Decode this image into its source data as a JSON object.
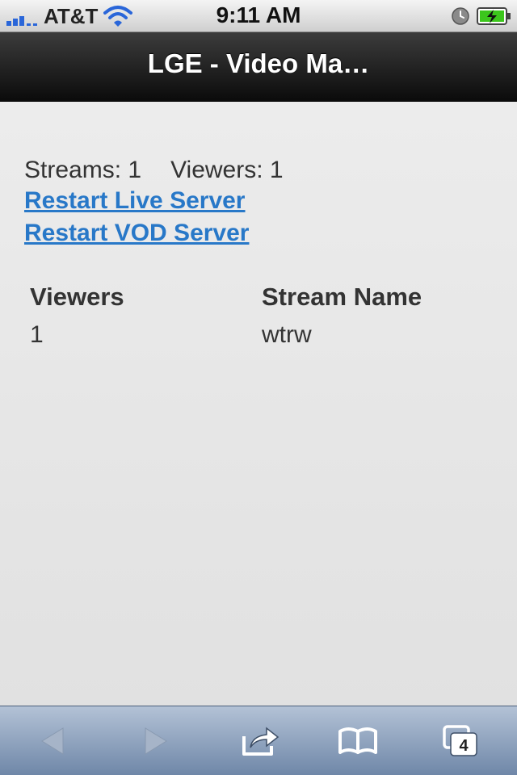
{
  "status_bar": {
    "carrier": "AT&T",
    "time": "9:11 AM"
  },
  "header": {
    "title": "LGE - Video Ma…"
  },
  "summary": {
    "streams": "Streams: 1",
    "viewers": "Viewers: 1"
  },
  "links": {
    "restart_live": "Restart Live Server",
    "restart_vod": "Restart VOD Server"
  },
  "table": {
    "headers": [
      "Viewers",
      "Stream Name"
    ],
    "rows": [
      [
        "1",
        "wtrw"
      ]
    ]
  },
  "toolbar": {
    "icons": [
      "back-icon",
      "forward-icon",
      "share-icon",
      "bookmarks-icon",
      "tabs-icon"
    ],
    "tabs_count": "4"
  },
  "colors": {
    "link": "#2878c8",
    "signal": "#2a66d9",
    "battery_charge": "#3cc61c"
  }
}
